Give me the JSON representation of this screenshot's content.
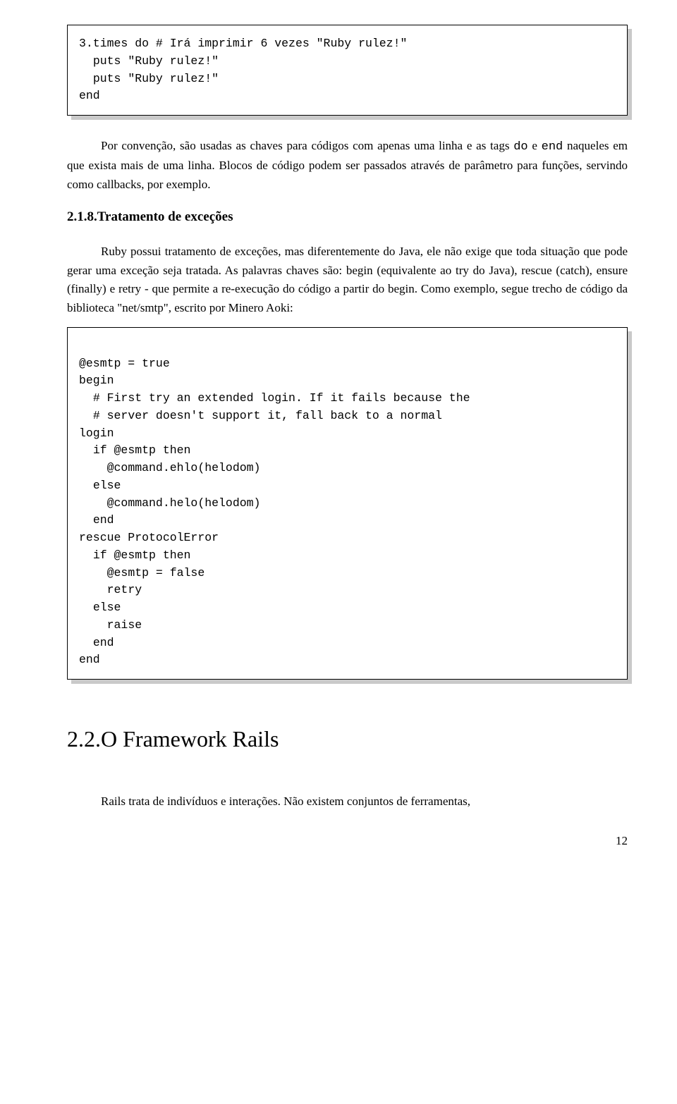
{
  "code_block_1": "3.times do # Irá imprimir 6 vezes \"Ruby rulez!\"\n  puts \"Ruby rulez!\"\n  puts \"Ruby rulez!\"\nend",
  "para1_a": "Por convenção, são usadas as chaves para códigos com apenas uma linha e as tags ",
  "do_tag": "do",
  "para1_b": " e ",
  "end_tag": "end",
  "para1_c": " naqueles em que exista mais de uma linha. Blocos de código podem ser passados através de parâmetro para funções, servindo como callbacks, por exemplo.",
  "section_heading": "2.1.8.Tratamento de exceções",
  "para2": "Ruby possui tratamento de exceções, mas diferentemente do Java, ele não exige que toda situação que pode gerar uma exceção seja tratada. As palavras chaves são: begin (equivalente ao try do Java), rescue (catch), ensure (finally) e retry - que permite a re-execução do código a partir do begin. Como exemplo, segue trecho de código da biblioteca \"net/smtp\", escrito por Minero Aoki:",
  "code_block_2": "\n@esmtp = true\nbegin\n  # First try an extended login. If it fails because the\n  # server doesn't support it, fall back to a normal \nlogin\n  if @esmtp then\n    @command.ehlo(helodom)\n  else\n    @command.helo(helodom) \n  end\nrescue ProtocolError\n  if @esmtp then\n    @esmtp = false\n    retry\n  else\n    raise\n  end\nend\n",
  "chapter_heading": "2.2.O Framework Rails",
  "para3": "Rails trata de indivíduos e interações. Não existem conjuntos de ferramentas,",
  "page_number": "12"
}
